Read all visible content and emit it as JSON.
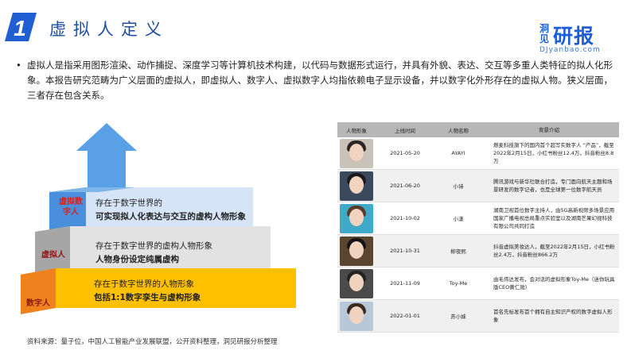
{
  "header": {
    "number": "1",
    "title": "虚拟人定义",
    "brand_vertical": "洞见",
    "brand_main": "研报",
    "brand_url": "DJyanbao.com"
  },
  "intro": {
    "bullet": "•",
    "text": "虚拟人是指采用图形渲染、动作捕捉、深度学习等计算机技术构建，以代码与数据形式运行，并具有外貌、表达、交互等多重人类特征的拟人化形象。本报告研究范畴为广义层面的虚拟人，即虚拟人、数字人、虚拟数字人均指依赖电子显示设备，并以数字化外形存在的虚拟人物。狭义层面，三者存在包含关系。"
  },
  "diagram": {
    "tiers": [
      {
        "side_label": "虚拟数字人",
        "line1": "存在于数字世界的",
        "line2": "可实现拟人化表达与交互的虚构人物形象",
        "color": "#d6e4f7"
      },
      {
        "side_label": "虚拟人",
        "line1": "存在于数字世界的虚构人物形象",
        "line2": "人物身份设定纯属虚构",
        "color": "#e2e2e2"
      },
      {
        "side_label": "数字人",
        "line1": "存在于数字世界的人物形象",
        "line2": "包括1:1数字孪生与虚构形象",
        "color": "#ffc000"
      }
    ],
    "colors": {
      "blue": "#5aa0e6",
      "gray": "#a6a6a6",
      "orange": "#f0821e",
      "red_label": "#d6231a"
    }
  },
  "source": "资料来源：量子位，中国人工智能产业发展联盟，公开资料整理，洞见研报分析整理",
  "table": {
    "headers": [
      "人物形象",
      "上线时间",
      "人物名称",
      "背景介绍"
    ],
    "rows": [
      {
        "date": "2021-05-20",
        "name": "AYAYI",
        "desc": "燃麦科技旗下的国内首个超写实数字人 “产品”，截至2022年2月15日，小红书粉丝12.4万，抖音粉丝8.8万",
        "tone": "#c9c2b9",
        "hair": "#2b2724"
      },
      {
        "date": "2021-06-20",
        "name": "小诗",
        "desc": "腾讯游戏与新华社联合打造，专门面向航天主题和场景研发的数字记者，也是全球第一位数字航天员",
        "tone": "#3a4a5c",
        "hair": "#1b1b1f"
      },
      {
        "date": "2021-10-02",
        "name": "小漾",
        "desc": "湖南卫视首位数字主持人，由5G高新视频多场景应用国家广播电视总局重点实验室以及湖南芒果幻视科技有限公司共同打造",
        "tone": "#3fa9c9",
        "hair": "#5a3a2a"
      },
      {
        "date": "2021-10-31",
        "name": "柳夜熙",
        "desc": "抖音虚拟美妆达人，截至2022年2月15日，小红书粉丝2.4万，抖音粉丝866.2万",
        "tone": "#5a4630",
        "hair": "#141414"
      },
      {
        "date": "2021-11-09",
        "name": "Toy-Me",
        "desc": "由毛伟达发布，会对话的虚拟形象Toy-Me（迷你玩具版CEO黄仁勋）",
        "tone": "#4a4a4a",
        "hair": "#222222"
      },
      {
        "date": "2022-01-01",
        "name": "苏小妹",
        "desc": "首名先标发布首个拥有自主知识产权的数字虚拟人形象",
        "tone": "#b8c8d8",
        "hair": "#3a2a22"
      }
    ]
  }
}
